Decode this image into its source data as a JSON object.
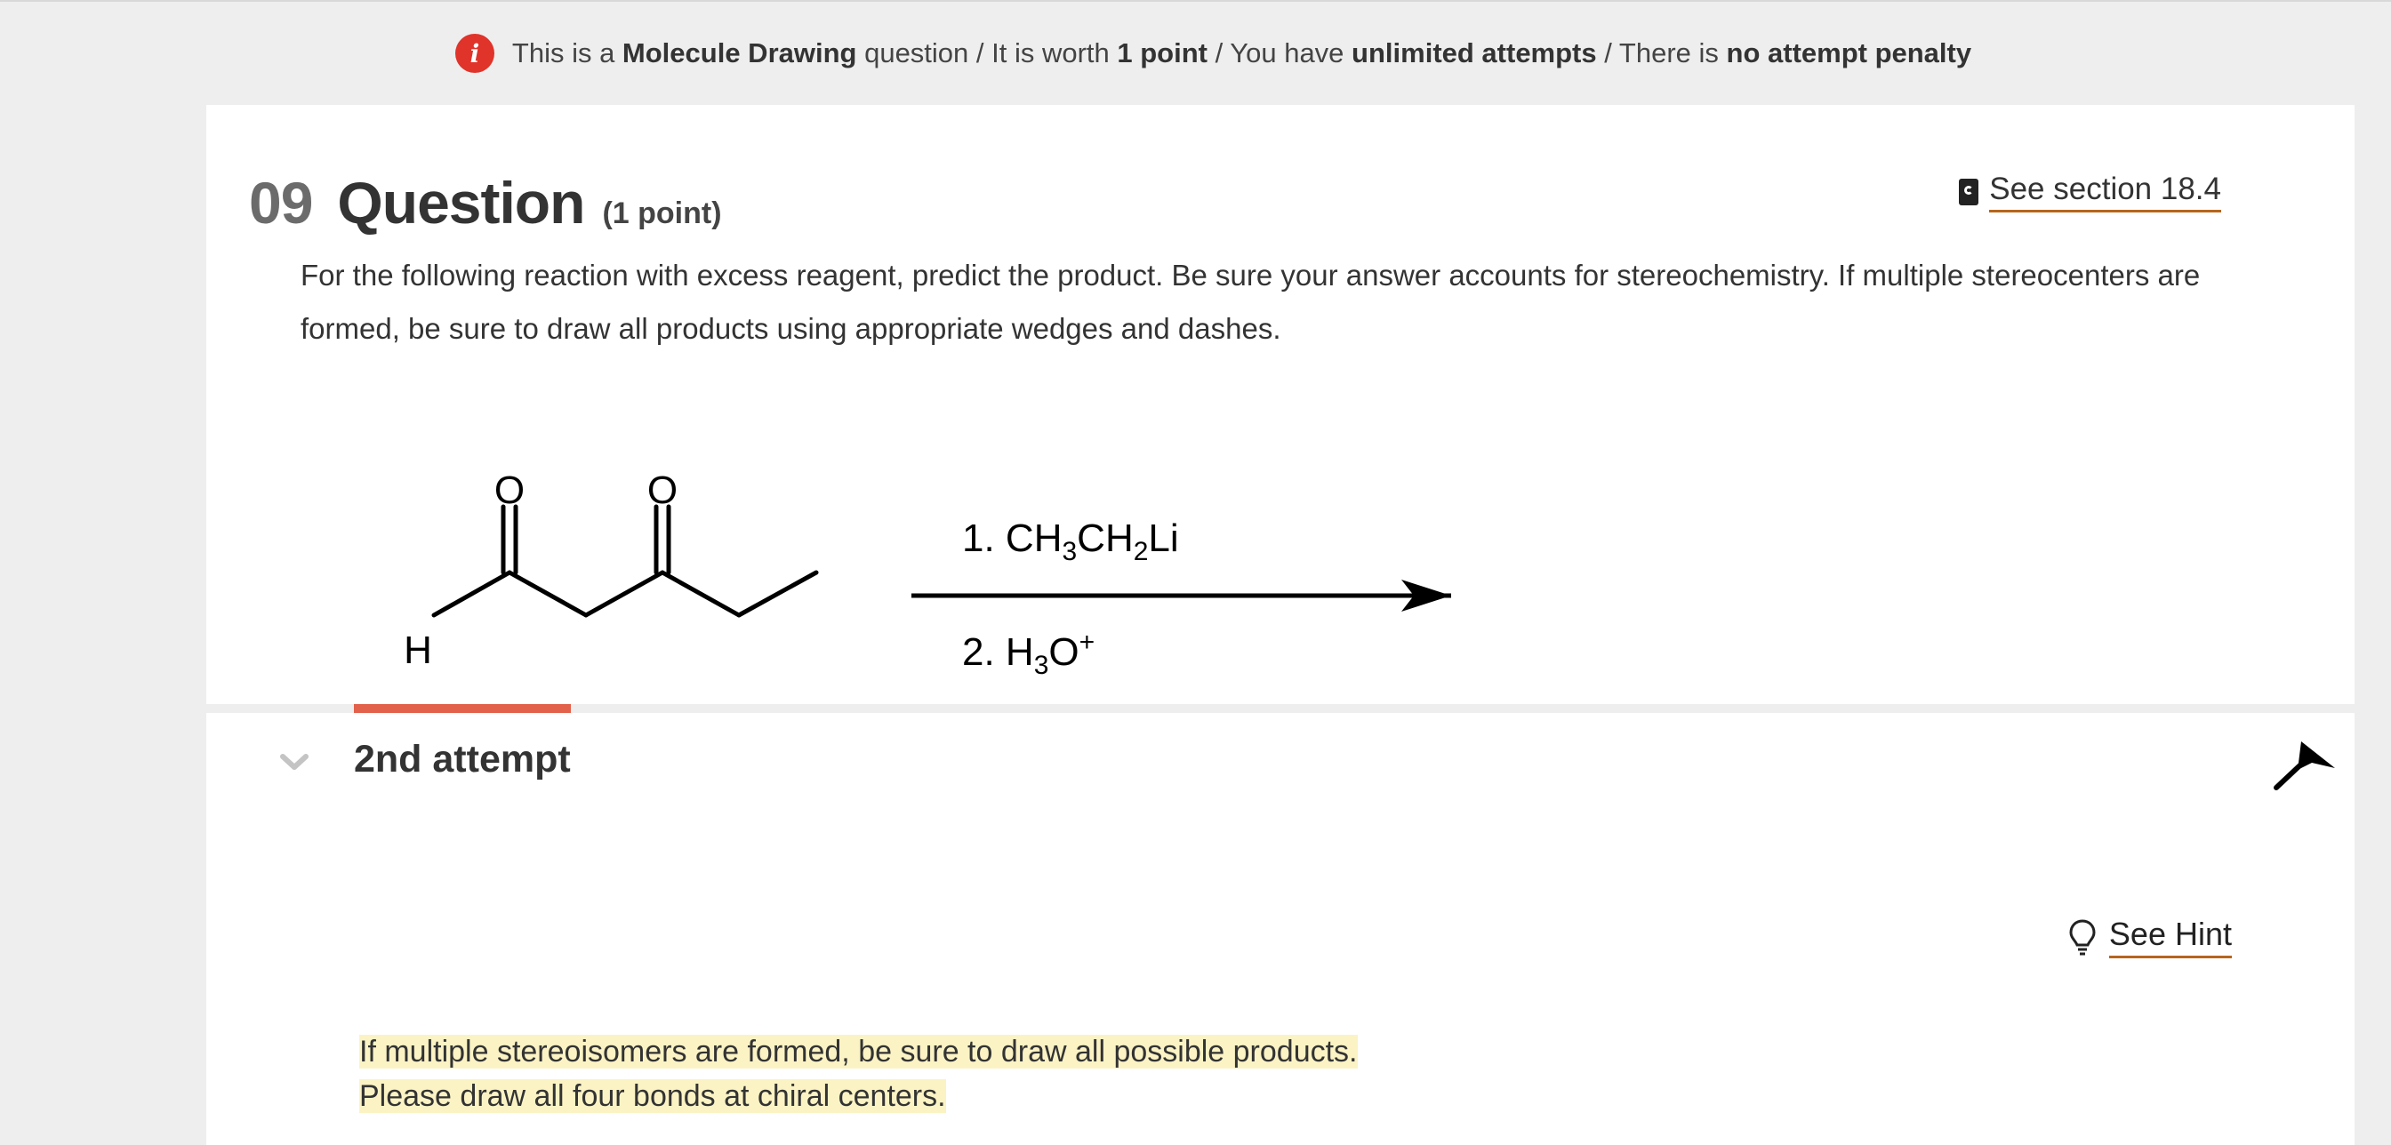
{
  "infobar": {
    "segments": [
      {
        "text": "This is a ",
        "bold": false
      },
      {
        "text": "Molecule Drawing",
        "bold": true
      },
      {
        "text": " question / It is worth ",
        "bold": false
      },
      {
        "text": "1 point",
        "bold": true
      },
      {
        "text": " / You have ",
        "bold": false
      },
      {
        "text": "unlimited attempts",
        "bold": true
      },
      {
        "text": " / There is ",
        "bold": false
      },
      {
        "text": "no attempt penalty",
        "bold": true
      }
    ],
    "icon": "info-icon",
    "icon_color": "#e0332a"
  },
  "question": {
    "number": "09",
    "title": "Question",
    "points": "(1 point)",
    "section_link": "See section 18.4",
    "prompt": "For the following reaction with excess reagent, predict the product. Be sure your answer accounts for stereochemistry. If multiple stereocenters are formed, be sure to draw all products using appropriate wedges and dashes."
  },
  "scheme": {
    "atom_o1": "O",
    "atom_o2": "O",
    "atom_h": "H",
    "reagent1_prefix": "1. CH",
    "reagent1_sub1": "3",
    "reagent1_mid": "CH",
    "reagent1_sub2": "2",
    "reagent1_suffix": "Li",
    "reagent2_prefix": "2. H",
    "reagent2_sub": "3",
    "reagent2_mid": "O",
    "reagent2_sup": "+"
  },
  "attempt": {
    "label": "2nd attempt",
    "accent_color": "#e2614a",
    "hint_label": "See Hint",
    "notes": [
      "If multiple stereoisomers are formed, be sure to draw all possible products.",
      "Please draw all four bonds at chiral centers."
    ]
  }
}
